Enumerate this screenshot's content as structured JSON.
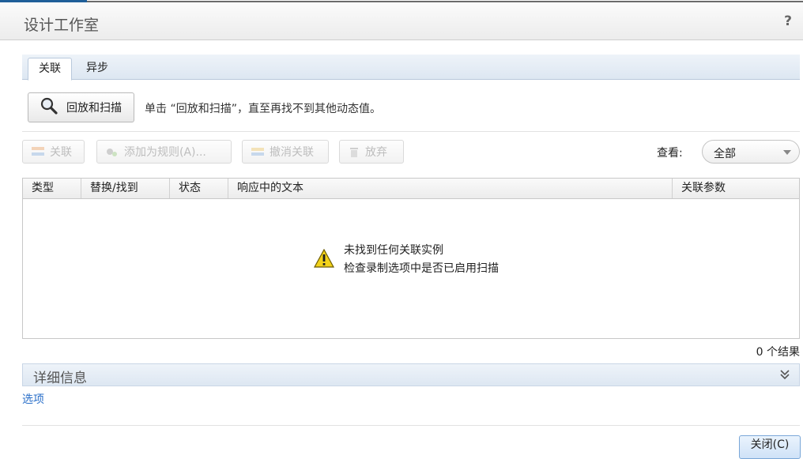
{
  "window": {
    "title": "设计工作室",
    "help": "?"
  },
  "tabs": [
    {
      "label": "关联",
      "active": true
    },
    {
      "label": "异步",
      "active": false
    }
  ],
  "scan": {
    "button_label": "回放和扫描",
    "hint": "单击 “回放和扫描”，直至再找不到其他动态值。"
  },
  "toolbar": {
    "correlate": "关联",
    "add_rule": "添加为规则(A)...",
    "undo_correlate": "撤消关联",
    "discard": "放弃",
    "view_label": "查看:",
    "view_value": "全部"
  },
  "grid": {
    "columns": [
      "类型",
      "替换/找到",
      "状态",
      "响应中的文本",
      "关联参数"
    ],
    "empty_line1": "未找到任何关联实例",
    "empty_line2": "检查录制选项中是否已启用扫描"
  },
  "results": "0 个结果",
  "details": {
    "label": "详细信息"
  },
  "options_link": "选项",
  "close_button": "关闭(C)",
  "colors": {
    "accent_blue": "#2a6fc9",
    "header_band": "#dde7f2",
    "warning": "#f2d21a"
  }
}
